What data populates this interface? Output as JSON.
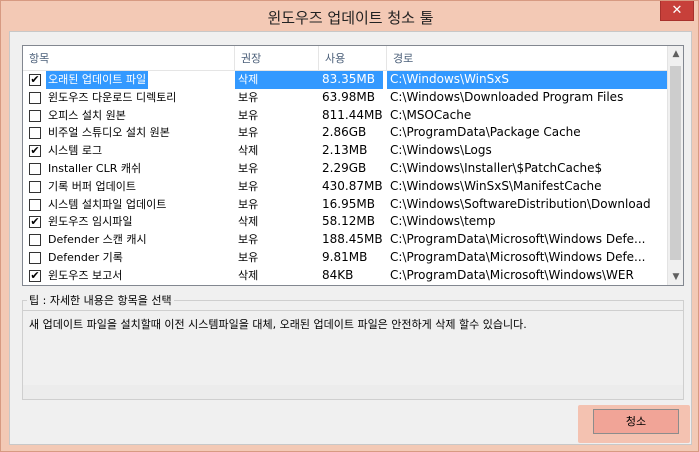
{
  "window": {
    "title": "윈도우즈 업데이트 청소 툴",
    "close_label": "✕"
  },
  "list": {
    "headers": [
      "항목",
      "권장",
      "사용",
      "경로"
    ],
    "rows": [
      {
        "checked": true,
        "selected": true,
        "name": "오래된 업데이트 파일",
        "rec": "삭제",
        "size": "83.35MB",
        "path": "C:\\Windows\\WinSxS"
      },
      {
        "checked": false,
        "selected": false,
        "name": "윈도우즈 다운로드 디렉토리",
        "rec": "보유",
        "size": "63.98MB",
        "path": "C:\\Windows\\Downloaded Program Files"
      },
      {
        "checked": false,
        "selected": false,
        "name": "오피스 설치 원본",
        "rec": "보유",
        "size": "811.44MB",
        "path": "C:\\MSOCache"
      },
      {
        "checked": false,
        "selected": false,
        "name": "비주얼 스튜디오 설치 원본",
        "rec": "보유",
        "size": "2.86GB",
        "path": "C:\\ProgramData\\Package Cache"
      },
      {
        "checked": true,
        "selected": false,
        "name": "시스템 로그",
        "rec": "삭제",
        "size": "2.13MB",
        "path": "C:\\Windows\\Logs"
      },
      {
        "checked": false,
        "selected": false,
        "name": "Installer CLR 캐쉬",
        "rec": "보유",
        "size": "2.29GB",
        "path": "C:\\Windows\\Installer\\$PatchCache$"
      },
      {
        "checked": false,
        "selected": false,
        "name": "기록 버퍼 업데이트",
        "rec": "보유",
        "size": "430.87MB",
        "path": "C:\\Windows\\WinSxS\\ManifestCache"
      },
      {
        "checked": false,
        "selected": false,
        "name": "시스템 설치파일 업데이트",
        "rec": "보유",
        "size": "16.95MB",
        "path": "C:\\Windows\\SoftwareDistribution\\Download"
      },
      {
        "checked": true,
        "selected": false,
        "name": "윈도우즈 임시파일",
        "rec": "삭제",
        "size": "58.12MB",
        "path": "C:\\Windows\\temp"
      },
      {
        "checked": false,
        "selected": false,
        "name": "Defender 스캔 캐시",
        "rec": "보유",
        "size": "188.45MB",
        "path": "C:\\ProgramData\\Microsoft\\Windows Defe..."
      },
      {
        "checked": false,
        "selected": false,
        "name": "Defender 기록",
        "rec": "보유",
        "size": "9.81MB",
        "path": "C:\\ProgramData\\Microsoft\\Windows Defe..."
      },
      {
        "checked": true,
        "selected": false,
        "name": "윈도우즈 보고서",
        "rec": "삭제",
        "size": "84KB",
        "path": "C:\\ProgramData\\Microsoft\\Windows\\WER"
      }
    ]
  },
  "tip": {
    "label": "팁 : 자세한 내용은 항목을 선택",
    "text": "새 업데이트 파일을 설치할때 이전 시스템파일을 대체, 오래된 업데이트 파일은 안전하게 삭제 할수 있습니다."
  },
  "clean_button_label": "청소",
  "colors": {
    "selection": "#3399ff",
    "titlebar": "#f3c9b5",
    "close": "#c7403a",
    "clean_button": "#f1a497"
  }
}
